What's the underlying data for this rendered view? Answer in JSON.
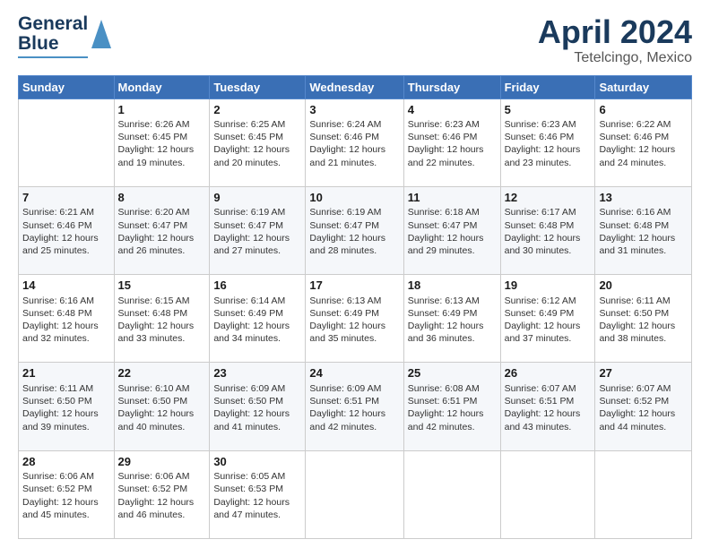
{
  "header": {
    "logo_line1": "General",
    "logo_line2": "Blue",
    "title": "April 2024",
    "subtitle": "Tetelcingo, Mexico"
  },
  "days_of_week": [
    "Sunday",
    "Monday",
    "Tuesday",
    "Wednesday",
    "Thursday",
    "Friday",
    "Saturday"
  ],
  "weeks": [
    [
      {
        "day": "",
        "sunrise": "",
        "sunset": "",
        "daylight": ""
      },
      {
        "day": "1",
        "sunrise": "Sunrise: 6:26 AM",
        "sunset": "Sunset: 6:45 PM",
        "daylight": "Daylight: 12 hours and 19 minutes."
      },
      {
        "day": "2",
        "sunrise": "Sunrise: 6:25 AM",
        "sunset": "Sunset: 6:45 PM",
        "daylight": "Daylight: 12 hours and 20 minutes."
      },
      {
        "day": "3",
        "sunrise": "Sunrise: 6:24 AM",
        "sunset": "Sunset: 6:46 PM",
        "daylight": "Daylight: 12 hours and 21 minutes."
      },
      {
        "day": "4",
        "sunrise": "Sunrise: 6:23 AM",
        "sunset": "Sunset: 6:46 PM",
        "daylight": "Daylight: 12 hours and 22 minutes."
      },
      {
        "day": "5",
        "sunrise": "Sunrise: 6:23 AM",
        "sunset": "Sunset: 6:46 PM",
        "daylight": "Daylight: 12 hours and 23 minutes."
      },
      {
        "day": "6",
        "sunrise": "Sunrise: 6:22 AM",
        "sunset": "Sunset: 6:46 PM",
        "daylight": "Daylight: 12 hours and 24 minutes."
      }
    ],
    [
      {
        "day": "7",
        "sunrise": "Sunrise: 6:21 AM",
        "sunset": "Sunset: 6:46 PM",
        "daylight": "Daylight: 12 hours and 25 minutes."
      },
      {
        "day": "8",
        "sunrise": "Sunrise: 6:20 AM",
        "sunset": "Sunset: 6:47 PM",
        "daylight": "Daylight: 12 hours and 26 minutes."
      },
      {
        "day": "9",
        "sunrise": "Sunrise: 6:19 AM",
        "sunset": "Sunset: 6:47 PM",
        "daylight": "Daylight: 12 hours and 27 minutes."
      },
      {
        "day": "10",
        "sunrise": "Sunrise: 6:19 AM",
        "sunset": "Sunset: 6:47 PM",
        "daylight": "Daylight: 12 hours and 28 minutes."
      },
      {
        "day": "11",
        "sunrise": "Sunrise: 6:18 AM",
        "sunset": "Sunset: 6:47 PM",
        "daylight": "Daylight: 12 hours and 29 minutes."
      },
      {
        "day": "12",
        "sunrise": "Sunrise: 6:17 AM",
        "sunset": "Sunset: 6:48 PM",
        "daylight": "Daylight: 12 hours and 30 minutes."
      },
      {
        "day": "13",
        "sunrise": "Sunrise: 6:16 AM",
        "sunset": "Sunset: 6:48 PM",
        "daylight": "Daylight: 12 hours and 31 minutes."
      }
    ],
    [
      {
        "day": "14",
        "sunrise": "Sunrise: 6:16 AM",
        "sunset": "Sunset: 6:48 PM",
        "daylight": "Daylight: 12 hours and 32 minutes."
      },
      {
        "day": "15",
        "sunrise": "Sunrise: 6:15 AM",
        "sunset": "Sunset: 6:48 PM",
        "daylight": "Daylight: 12 hours and 33 minutes."
      },
      {
        "day": "16",
        "sunrise": "Sunrise: 6:14 AM",
        "sunset": "Sunset: 6:49 PM",
        "daylight": "Daylight: 12 hours and 34 minutes."
      },
      {
        "day": "17",
        "sunrise": "Sunrise: 6:13 AM",
        "sunset": "Sunset: 6:49 PM",
        "daylight": "Daylight: 12 hours and 35 minutes."
      },
      {
        "day": "18",
        "sunrise": "Sunrise: 6:13 AM",
        "sunset": "Sunset: 6:49 PM",
        "daylight": "Daylight: 12 hours and 36 minutes."
      },
      {
        "day": "19",
        "sunrise": "Sunrise: 6:12 AM",
        "sunset": "Sunset: 6:49 PM",
        "daylight": "Daylight: 12 hours and 37 minutes."
      },
      {
        "day": "20",
        "sunrise": "Sunrise: 6:11 AM",
        "sunset": "Sunset: 6:50 PM",
        "daylight": "Daylight: 12 hours and 38 minutes."
      }
    ],
    [
      {
        "day": "21",
        "sunrise": "Sunrise: 6:11 AM",
        "sunset": "Sunset: 6:50 PM",
        "daylight": "Daylight: 12 hours and 39 minutes."
      },
      {
        "day": "22",
        "sunrise": "Sunrise: 6:10 AM",
        "sunset": "Sunset: 6:50 PM",
        "daylight": "Daylight: 12 hours and 40 minutes."
      },
      {
        "day": "23",
        "sunrise": "Sunrise: 6:09 AM",
        "sunset": "Sunset: 6:50 PM",
        "daylight": "Daylight: 12 hours and 41 minutes."
      },
      {
        "day": "24",
        "sunrise": "Sunrise: 6:09 AM",
        "sunset": "Sunset: 6:51 PM",
        "daylight": "Daylight: 12 hours and 42 minutes."
      },
      {
        "day": "25",
        "sunrise": "Sunrise: 6:08 AM",
        "sunset": "Sunset: 6:51 PM",
        "daylight": "Daylight: 12 hours and 42 minutes."
      },
      {
        "day": "26",
        "sunrise": "Sunrise: 6:07 AM",
        "sunset": "Sunset: 6:51 PM",
        "daylight": "Daylight: 12 hours and 43 minutes."
      },
      {
        "day": "27",
        "sunrise": "Sunrise: 6:07 AM",
        "sunset": "Sunset: 6:52 PM",
        "daylight": "Daylight: 12 hours and 44 minutes."
      }
    ],
    [
      {
        "day": "28",
        "sunrise": "Sunrise: 6:06 AM",
        "sunset": "Sunset: 6:52 PM",
        "daylight": "Daylight: 12 hours and 45 minutes."
      },
      {
        "day": "29",
        "sunrise": "Sunrise: 6:06 AM",
        "sunset": "Sunset: 6:52 PM",
        "daylight": "Daylight: 12 hours and 46 minutes."
      },
      {
        "day": "30",
        "sunrise": "Sunrise: 6:05 AM",
        "sunset": "Sunset: 6:53 PM",
        "daylight": "Daylight: 12 hours and 47 minutes."
      },
      {
        "day": "",
        "sunrise": "",
        "sunset": "",
        "daylight": ""
      },
      {
        "day": "",
        "sunrise": "",
        "sunset": "",
        "daylight": ""
      },
      {
        "day": "",
        "sunrise": "",
        "sunset": "",
        "daylight": ""
      },
      {
        "day": "",
        "sunrise": "",
        "sunset": "",
        "daylight": ""
      }
    ]
  ]
}
